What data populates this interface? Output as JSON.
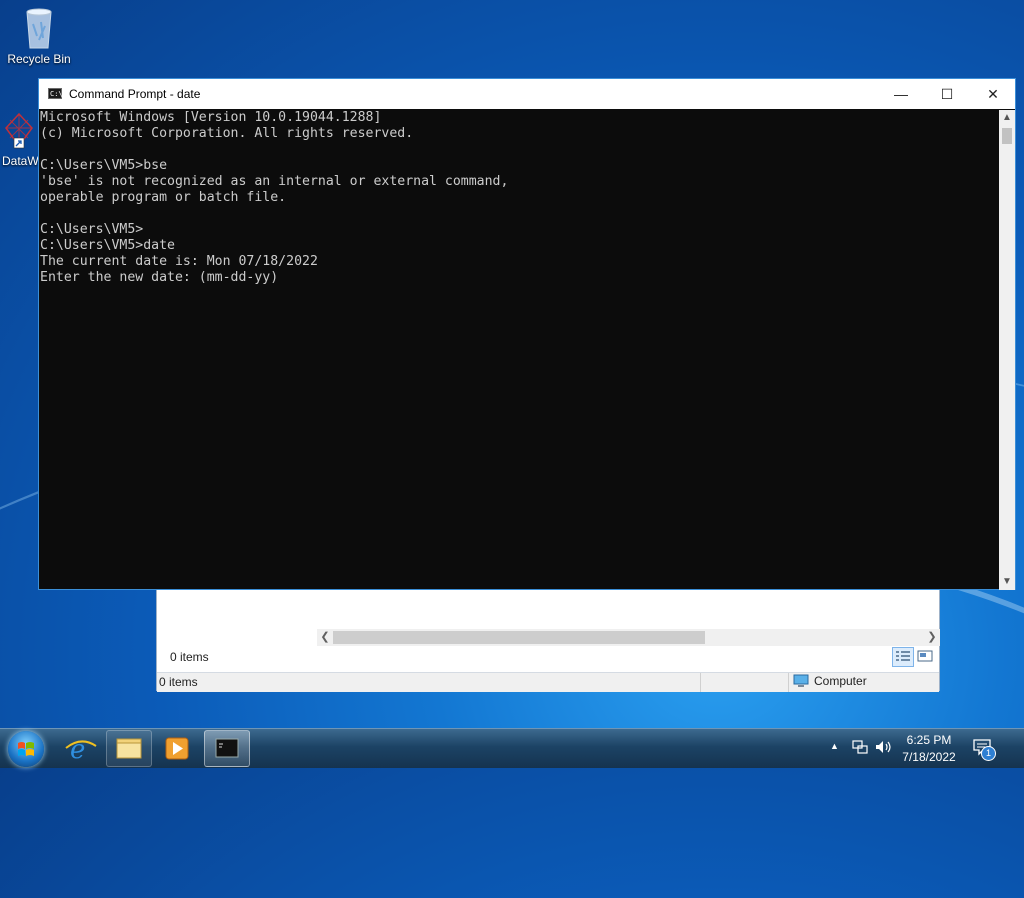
{
  "desktop": {
    "icons": [
      {
        "label": "Recycle Bin"
      },
      {
        "label": "DataW"
      }
    ]
  },
  "console_window": {
    "title": "Command Prompt - date",
    "lines": [
      "Microsoft Windows [Version 10.0.19044.1288]",
      "(c) Microsoft Corporation. All rights reserved.",
      "",
      "C:\\Users\\VM5>bse",
      "'bse' is not recognized as an internal or external command,",
      "operable program or batch file.",
      "",
      "C:\\Users\\VM5>",
      "C:\\Users\\VM5>date",
      "The current date is: Mon 07/18/2022",
      "Enter the new date: (mm-dd-yy)"
    ],
    "minimize_glyph": "—",
    "maximize_glyph": "☐",
    "close_glyph": "✕"
  },
  "explorer_window": {
    "items_count": "0 items",
    "status_items": "0 items",
    "status_location": "Computer"
  },
  "taskbar": {
    "pinned": [
      "start-orb",
      "internet-explorer-icon",
      "file-explorer-icon",
      "media-player-icon",
      "command-prompt-icon"
    ],
    "tray_arrow": "▲",
    "clock_time": "6:25 PM",
    "clock_date": "7/18/2022",
    "notification_count": "1"
  },
  "colors": {
    "console_bg": "#0c0c0c",
    "console_text": "#cccccc",
    "titlebar_bg": "#ffffff",
    "window_border": "#3b8fd8"
  }
}
